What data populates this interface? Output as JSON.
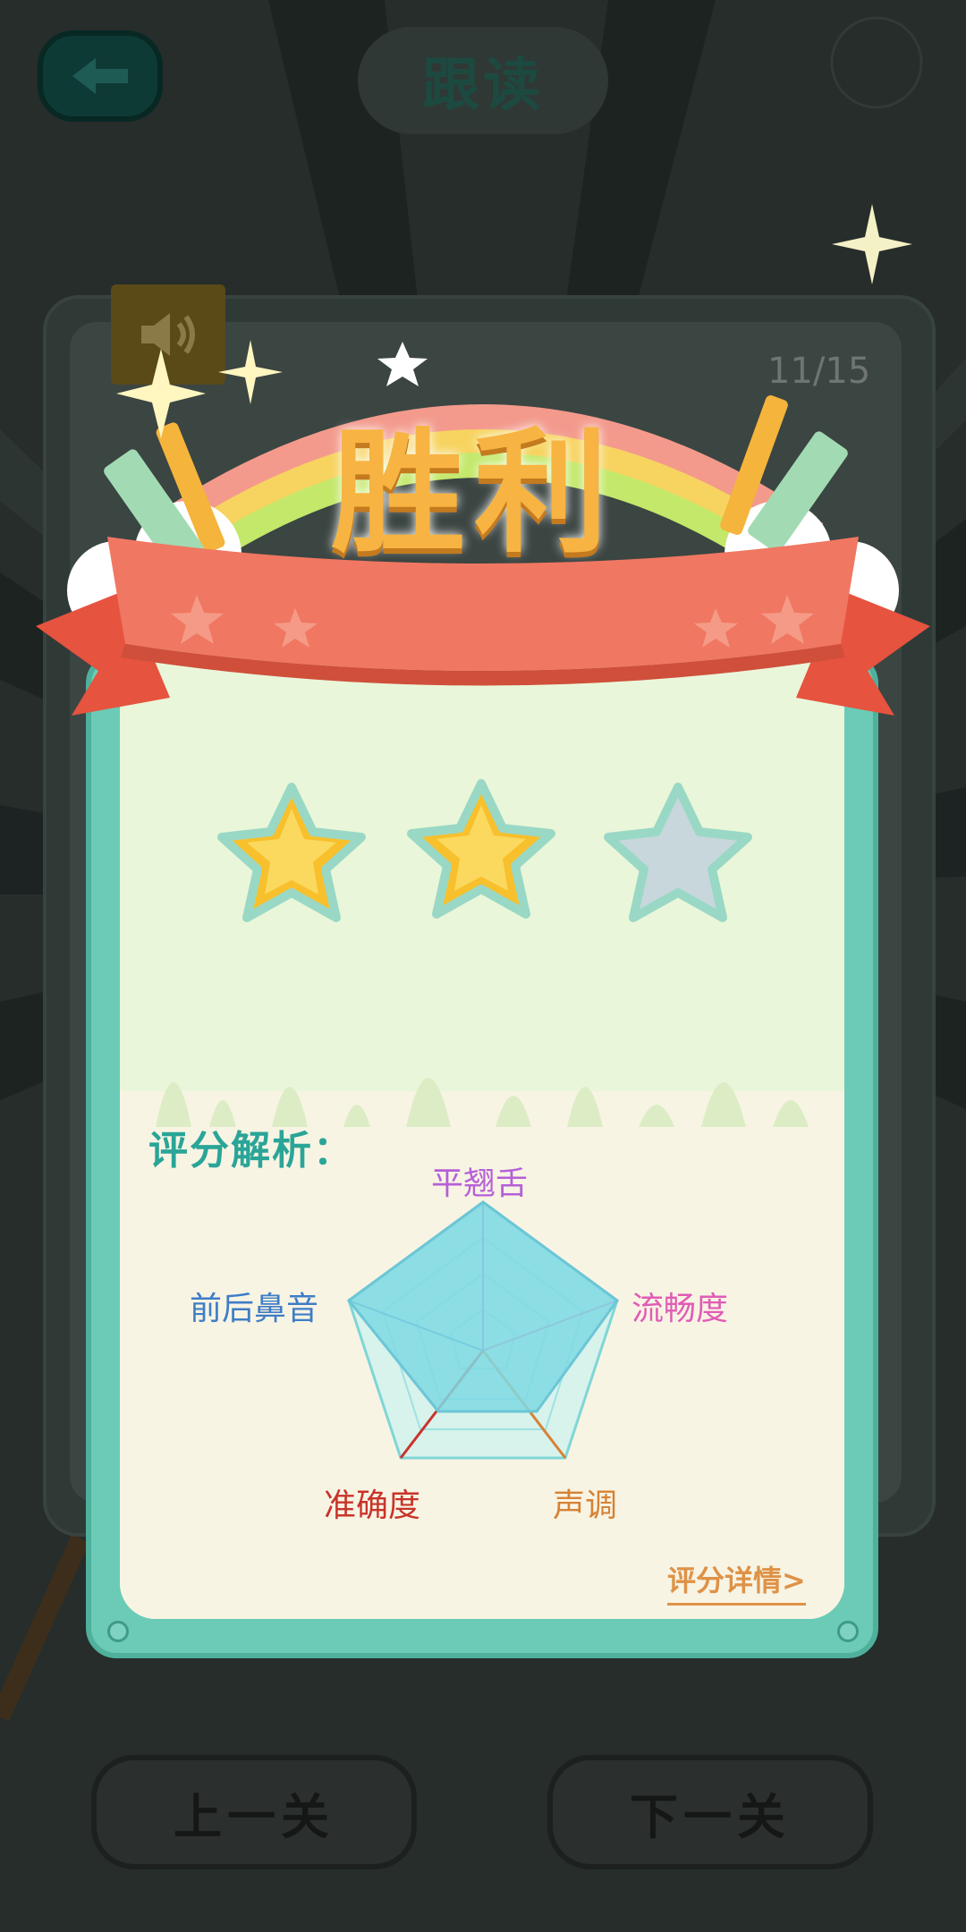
{
  "header": {
    "title": "跟读",
    "back_icon": "back-arrow-icon"
  },
  "card_bg": {
    "page_counter": "11/15",
    "sound_icon": "speaker-icon"
  },
  "banner": {
    "title": "胜利"
  },
  "rating": {
    "stars_earned": 2,
    "stars_total": 3
  },
  "analysis": {
    "title": "评分解析：",
    "radar": {
      "labels": [
        {
          "text": "平翘舌",
          "color": "#b660d8"
        },
        {
          "text": "流畅度",
          "color": "#e05cb5"
        },
        {
          "text": "声调",
          "color": "#d68235"
        },
        {
          "text": "准确度",
          "color": "#c8342a"
        },
        {
          "text": "前后鼻音",
          "color": "#3f7dc6"
        }
      ]
    },
    "details_link": "评分详情>"
  },
  "nav": {
    "prev_label": "上一关",
    "next_label": "下一关"
  },
  "colors": {
    "accent": "#6bcbb6",
    "banner_red": "#ef6a55",
    "star_gold": "#f7c02c",
    "star_empty": "#c8d7dc"
  }
}
